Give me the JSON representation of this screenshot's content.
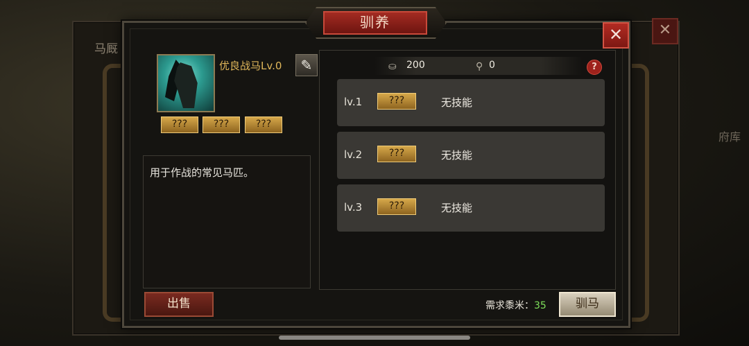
{
  "background": {
    "title": "马厩",
    "close_label": "✕",
    "side_label": "府库"
  },
  "dialog": {
    "title": "驯养",
    "close_label": "✕"
  },
  "horse": {
    "name": "优良战马Lv.0",
    "edit_icon": "brush-icon",
    "skills": [
      "???",
      "???",
      "???"
    ],
    "description": "用于作战的常见马匹。"
  },
  "resources": [
    {
      "icon": "grain-icon",
      "value": "200"
    },
    {
      "icon": "whip-icon",
      "value": "0"
    }
  ],
  "help_label": "?",
  "levels": [
    {
      "level": "lv.1",
      "skill_chip": "???",
      "skill_text": "无技能"
    },
    {
      "level": "lv.2",
      "skill_chip": "???",
      "skill_text": "无技能"
    },
    {
      "level": "lv.3",
      "skill_chip": "???",
      "skill_text": "无技能"
    }
  ],
  "footer": {
    "sell_label": "出售",
    "requirement_label": "需求黍米：",
    "requirement_value": "35",
    "tame_label": "驯马"
  },
  "colors": {
    "gold_chip": "#d6a84a",
    "title_red": "#a32b22",
    "requirement_green": "#7ee05a"
  }
}
